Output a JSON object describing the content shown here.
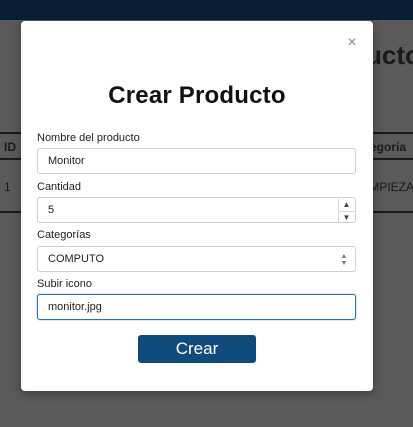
{
  "background": {
    "title": "ucto",
    "table": {
      "headers": [
        "ID",
        "egoría"
      ],
      "row": [
        "1",
        "IMPIEZA"
      ]
    }
  },
  "modal": {
    "close_symbol": "×",
    "title": "Crear Producto",
    "fields": {
      "name": {
        "label": "Nombre del producto",
        "value": "Monitor"
      },
      "quantity": {
        "label": "Cantidad",
        "value": "5"
      },
      "category": {
        "label": "Categorías",
        "value": "COMPUTO"
      },
      "icon": {
        "label": "Subir icono",
        "value": "monitor.jpg"
      }
    },
    "submit_label": "Crear"
  },
  "colors": {
    "primary_button": "#0f4b7c",
    "focus_border": "#2a73b7",
    "topbar": "#0b1e33"
  }
}
